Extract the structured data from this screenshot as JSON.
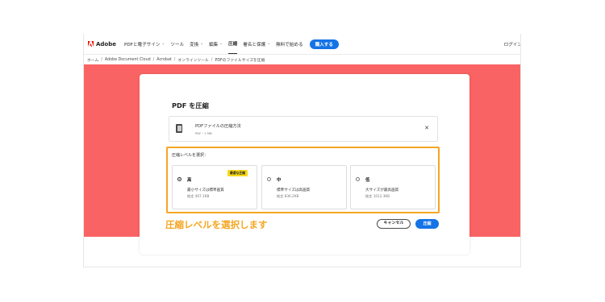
{
  "brand": {
    "name": "Adobe",
    "color": "#eb1000"
  },
  "nav": {
    "items": [
      {
        "label": "PDFと電子サイン",
        "dropdown": true
      },
      {
        "label": "ツール",
        "dropdown": false
      },
      {
        "label": "変換",
        "dropdown": true
      },
      {
        "label": "編集",
        "dropdown": true
      },
      {
        "label": "圧縮",
        "dropdown": false
      },
      {
        "label": "署名と保護",
        "dropdown": true
      },
      {
        "label": "無料で始める",
        "dropdown": false
      }
    ],
    "buy_label": "購入する",
    "login_label": "ログイン",
    "chevron": "⌄"
  },
  "breadcrumb": {
    "items": [
      "ホーム",
      "Adobe Document Cloud",
      "Acrobat",
      "オンラインツール",
      "PDFのファイルサイズを圧縮"
    ],
    "separator": "/"
  },
  "dialog": {
    "title": "PDF を圧縮",
    "file": {
      "name": "PDFファイルの圧縮方法",
      "meta": "PDF・1 MB",
      "close_icon": "✕"
    },
    "level_label": "圧縮レベルを選択：",
    "options": [
      {
        "name": "高",
        "badge": "最適な圧縮",
        "desc": "最小サイズは標準画質",
        "estimate": "推定 407.1KB",
        "selected": true
      },
      {
        "name": "中",
        "desc": "標準サイズは高画質",
        "estimate": "推定 836.2KB",
        "selected": false
      },
      {
        "name": "低",
        "desc": "大サイズが最高画質",
        "estimate": "推定 1012.3KB",
        "selected": false
      }
    ],
    "cancel_label": "キャンセル",
    "compress_label": "圧縮"
  },
  "annotation": {
    "text": "圧縮レベルを選択します",
    "color": "#f5a623"
  },
  "colors": {
    "hero": "#fa6363",
    "accent_blue": "#1473e6",
    "badge_yellow": "#f8d91b"
  }
}
